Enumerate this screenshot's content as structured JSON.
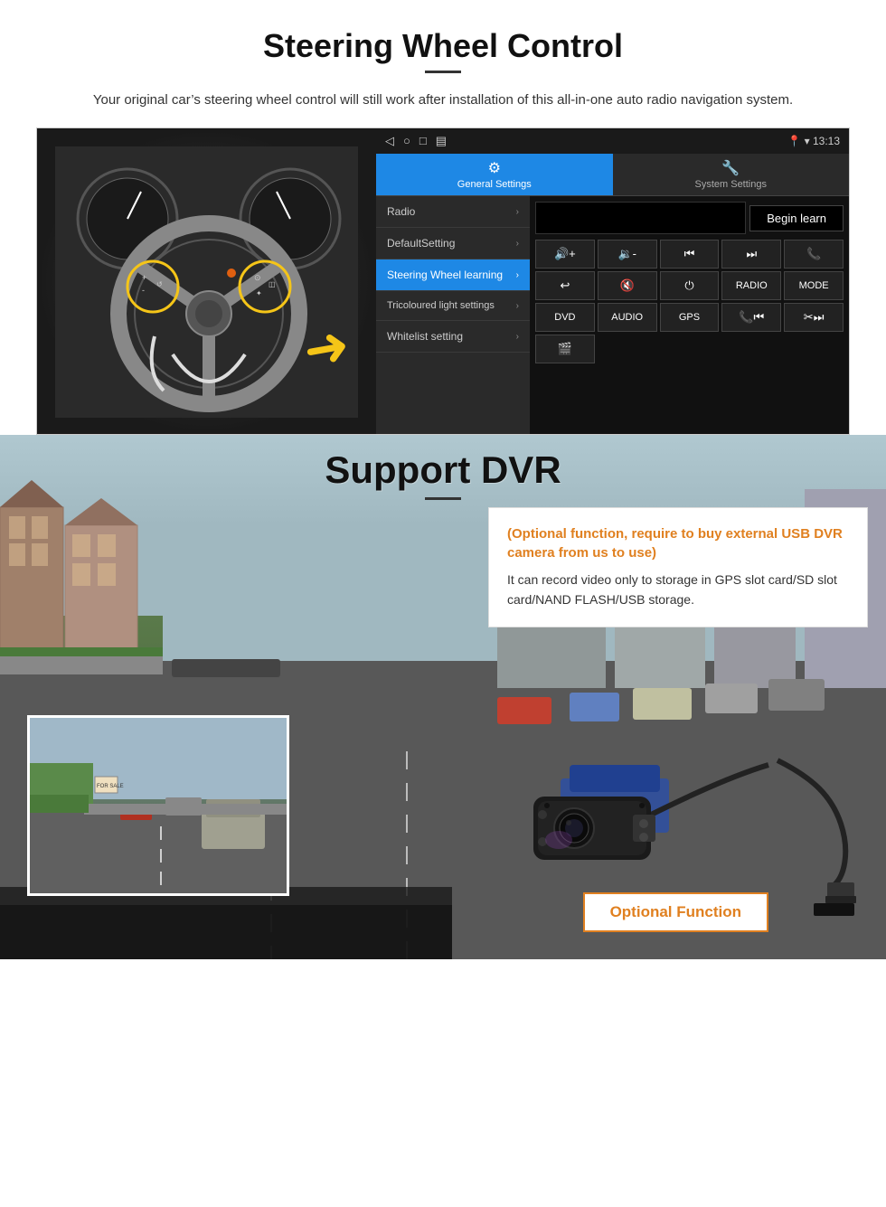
{
  "swc": {
    "title": "Steering Wheel Control",
    "subtitle": "Your original car’s steering wheel control will still work after installation of this all-in-one auto radio navigation system.",
    "android": {
      "time": "13:13",
      "tab_general": "General Settings",
      "tab_system": "System Settings",
      "menu_radio": "Radio",
      "menu_default": "DefaultSetting",
      "menu_steering": "Steering Wheel learning",
      "menu_tricolour": "Tricoloured light settings",
      "menu_whitelist": "Whitelist setting",
      "begin_learn": "Begin learn",
      "buttons": [
        "▶⁺",
        "◄⁺",
        "⏮",
        "⏭",
        "☎",
        "↩",
        "🔇",
        "⏻",
        "RADIO",
        "MODE",
        "DVD",
        "AUDIO",
        "GPS",
        "☎⏮",
        "✂⏭"
      ]
    }
  },
  "dvr": {
    "title": "Support DVR",
    "info_optional": "(Optional function, require to buy external USB DVR camera from us to use)",
    "info_text": "It can record video only to storage in GPS slot card/SD slot card/NAND FLASH/USB storage.",
    "optional_function": "Optional Function"
  }
}
